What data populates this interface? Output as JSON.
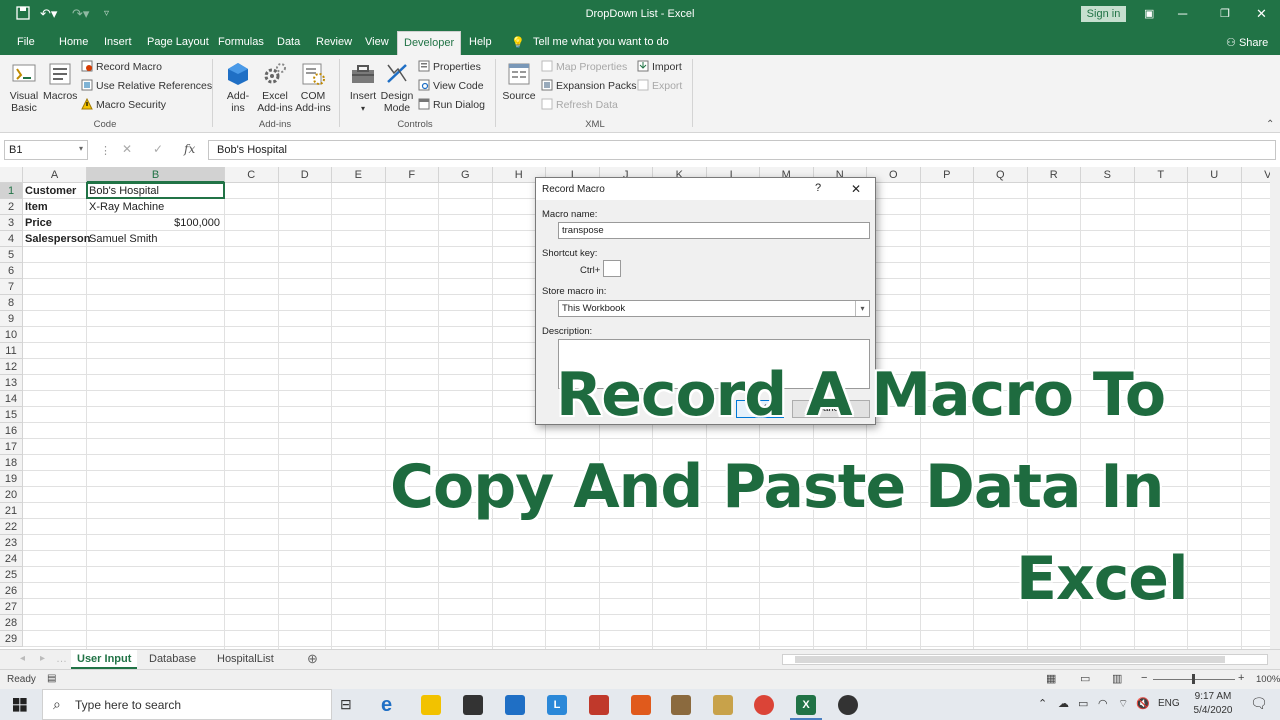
{
  "window": {
    "title": "DropDown List  -  Excel",
    "sign_in": "Sign in",
    "share": "Share"
  },
  "tabs": [
    "File",
    "Home",
    "Insert",
    "Page Layout",
    "Formulas",
    "Data",
    "Review",
    "View",
    "Developer",
    "Help"
  ],
  "active_tab": "Developer",
  "tell_me": "Tell me what you want to do",
  "ribbon": {
    "code": {
      "label": "Code",
      "visual_basic": [
        "Visual",
        "Basic"
      ],
      "macros": "Macros",
      "record_macro": "Record Macro",
      "use_relative": "Use Relative References",
      "macro_security": "Macro Security"
    },
    "addins": {
      "label": "Add-ins",
      "addins": [
        "Add-",
        "ins"
      ],
      "excel_addins": [
        "Excel",
        "Add-ins"
      ],
      "com_addins": [
        "COM",
        "Add-ins"
      ]
    },
    "controls": {
      "label": "Controls",
      "insert": "Insert",
      "design_mode": [
        "Design",
        "Mode"
      ],
      "properties": "Properties",
      "view_code": "View Code",
      "run_dialog": "Run Dialog"
    },
    "xml": {
      "label": "XML",
      "source": "Source",
      "map_properties": "Map Properties",
      "expansion_packs": "Expansion Packs",
      "refresh_data": "Refresh Data",
      "import": "Import",
      "export": "Export"
    }
  },
  "formula_bar": {
    "name_box": "B1",
    "content": "Bob's Hospital",
    "fx": "fx"
  },
  "columns": [
    "A",
    "B",
    "C",
    "D",
    "E",
    "F",
    "G",
    "H",
    "I",
    "J",
    "K",
    "L",
    "M",
    "N",
    "O",
    "P",
    "Q",
    "R",
    "S",
    "T",
    "U",
    "V"
  ],
  "rows": [
    "1",
    "2",
    "3",
    "4",
    "5",
    "6",
    "7",
    "8",
    "9",
    "10",
    "11",
    "12",
    "13",
    "14",
    "15",
    "16",
    "17",
    "18",
    "19",
    "20",
    "21",
    "22",
    "23",
    "24",
    "25",
    "26",
    "27",
    "28",
    "29"
  ],
  "cells": {
    "A1": "Customer",
    "B1": "Bob's Hospital",
    "A2": "Item",
    "B2": "X-Ray Machine",
    "A3": "Price",
    "B3": "$100,000",
    "A4": "Salesperson",
    "B4": "Samuel Smith"
  },
  "sheets": [
    "User Input",
    "Database",
    "HospitalList"
  ],
  "active_sheet": "User Input",
  "status": {
    "ready": "Ready",
    "zoom": "100%"
  },
  "dialog": {
    "title": "Record Macro",
    "help": "?",
    "close": "✕",
    "macro_name_label": "Macro name:",
    "macro_name_value": "transpose",
    "shortcut_label": "Shortcut key:",
    "ctrl": "Ctrl+",
    "store_label": "Store macro in:",
    "store_value": "This Workbook",
    "description_label": "Description:",
    "ok": "OK",
    "cancel": "Cancel"
  },
  "overlay": {
    "line1": "Record A Macro To",
    "line2": "Copy And Paste Data In",
    "line3": "Excel"
  },
  "taskbar": {
    "search_placeholder": "Type here to search",
    "lang": "ENG",
    "time": "9:17 AM",
    "date": "5/4/2020"
  },
  "colors": {
    "excel_green": "#217346",
    "overlay_green": "#1e6b3f"
  }
}
